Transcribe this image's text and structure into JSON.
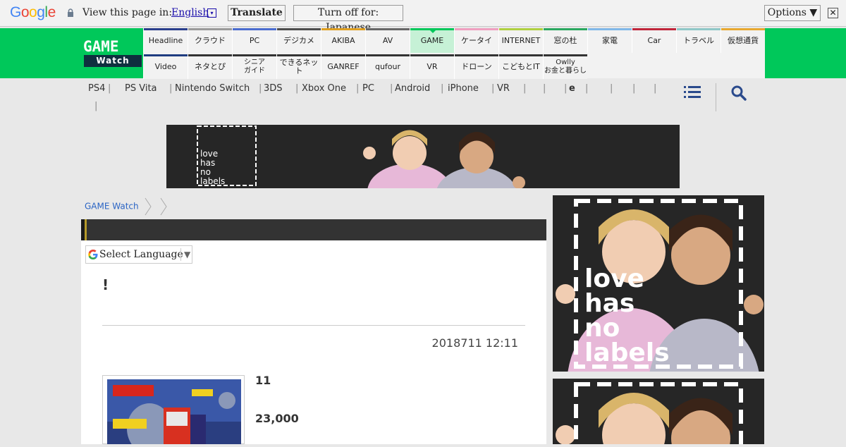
{
  "translate_bar": {
    "brand": "Google",
    "prompt": "View this page in:",
    "language": "English",
    "language_arrow": "▾",
    "translate_btn": "Translate",
    "turn_off_btn": "Turn off for: Japanese",
    "options_btn": "Options ▼",
    "close": "✕"
  },
  "site": {
    "logo_top": "GAME",
    "logo_bottom": "Watch"
  },
  "nav_row1": [
    {
      "label": "Headline",
      "color": "#2a3f8c"
    },
    {
      "label": "クラウド",
      "color": "#9a9a9a"
    },
    {
      "label": "PC",
      "color": "#4a6ccf"
    },
    {
      "label": "デジカメ",
      "color": "#4d4d4d"
    },
    {
      "label": "AKIBA",
      "color": "#e0a020"
    },
    {
      "label": "AV",
      "color": "#666666"
    },
    {
      "label": "GAME",
      "color": "#00c85a",
      "active": true
    },
    {
      "label": "ケータイ",
      "color": "#f0a0c0"
    },
    {
      "label": "INTERNET",
      "color": "#b0d040"
    },
    {
      "label": "窓の杜",
      "color": "#2aa860"
    },
    {
      "label": "家電",
      "color": "#80b8e8"
    },
    {
      "label": "Car",
      "color": "#c0253a"
    },
    {
      "label": "トラベル",
      "color": "#90c8c8"
    },
    {
      "label": "仮想通貨",
      "color": "#e8a830"
    }
  ],
  "nav_row2": [
    {
      "label": "Video",
      "color": "#1f3c80"
    },
    {
      "label": "ネタとぴ",
      "color": "#333333"
    },
    {
      "label": "シニア\nガイド",
      "color": "#333333"
    },
    {
      "label": "できるネット",
      "color": "#333333"
    },
    {
      "label": "GANREF",
      "color": "#333333"
    },
    {
      "label": "qufour",
      "color": "#333333"
    },
    {
      "label": "VR",
      "color": "#333333"
    },
    {
      "label": "ドローン",
      "color": "#333333"
    },
    {
      "label": "こどもとIT",
      "color": "#333333"
    },
    {
      "label": "Owlly\nお金と暮らし",
      "color": "#333333"
    }
  ],
  "sub_nav": {
    "items": [
      "PS4",
      "PS Vita",
      "Nintendo Switch",
      "3DS",
      "Xbox One",
      "PC",
      "Android",
      "iPhone",
      "VR",
      "",
      "",
      "e",
      "",
      "",
      "",
      ""
    ],
    "separator": "|"
  },
  "ads": {
    "banner_text": "love\nhas\nno\nlabels"
  },
  "breadcrumb": {
    "home": "GAME Watch"
  },
  "language_select": {
    "label": "Select Language",
    "arrow": "▼"
  },
  "article": {
    "title": "!",
    "date": "2018711 12:11",
    "line1": "11",
    "line2": "23,000"
  },
  "icons": [
    "google-logo",
    "lock-icon",
    "menu-icon",
    "search-icon",
    "close-icon",
    "chevron-right-icon"
  ]
}
